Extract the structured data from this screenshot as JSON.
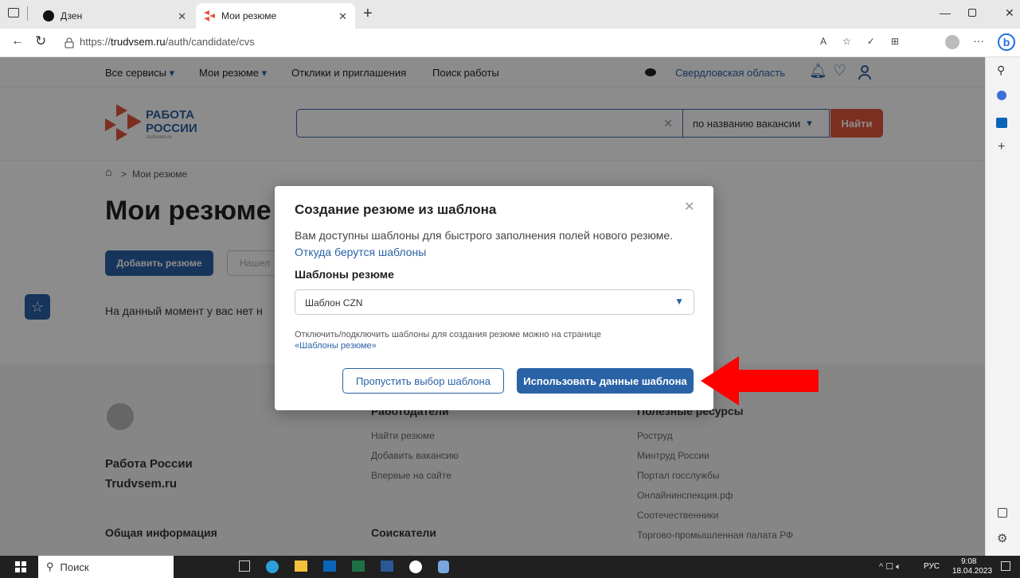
{
  "browser": {
    "tabs": [
      {
        "title": "Дзен"
      },
      {
        "title": "Мои резюме"
      }
    ],
    "url_prefix": "https://",
    "url_domain": "trudvsem.ru",
    "url_path": "/auth/candidate/cvs"
  },
  "topnav": {
    "items": [
      "Все сервисы",
      "Мои резюме",
      "Отклики и приглашения",
      "Поиск работы"
    ],
    "region": "Свердловская область"
  },
  "header": {
    "logo_line1": "РАБОТА",
    "logo_line2": "РОССИИ",
    "logo_small": "trudvsem.ru",
    "search_placeholder": "",
    "search_mode": "по названию вакансии",
    "search_button": "Найти"
  },
  "content": {
    "breadcrumb_sep": ">",
    "breadcrumb": "Мои резюме",
    "title": "Мои резюме",
    "add_button": "Добавить резюме",
    "second_button": "Нашел",
    "empty_text": "На данный момент у вас нет н"
  },
  "footer": {
    "org_name": "Работа России",
    "org_site": "Trudvsem.ru",
    "general": "Общая информация",
    "employers_heading": "Работодатели",
    "employers": [
      "Найти резюме",
      "Добавить вакансию",
      "Впервые на сайте"
    ],
    "seekers_heading": "Соискатели",
    "resources_heading": "Полезные ресурсы",
    "resources": [
      "Роструд",
      "Минтруд России",
      "Портал госслужбы",
      "Онлайнинспекция.рф",
      "Соотечественники",
      "Торгово-промышленная палата РФ"
    ]
  },
  "modal": {
    "title": "Создание резюме из шаблона",
    "desc": "Вам доступны шаблоны для быстрого заполнения полей нового резюме.",
    "desc_link": "Откуда берутся шаблоны",
    "select_label": "Шаблоны резюме",
    "select_value": "Шаблон CZN",
    "note": "Отключить/подключить шаблоны для создания резюме можно на странице",
    "note_link": "«Шаблоны резюме»",
    "skip_button": "Пропустить выбор шаблона",
    "use_button": "Использовать данные шаблона"
  },
  "taskbar": {
    "search": "Поиск",
    "lang": "РУС",
    "time": "9:08",
    "date": "18.04.2023"
  },
  "colors": {
    "primary": "#2a62a6",
    "accent_red": "#e2563d",
    "arrow": "#ff0000"
  }
}
